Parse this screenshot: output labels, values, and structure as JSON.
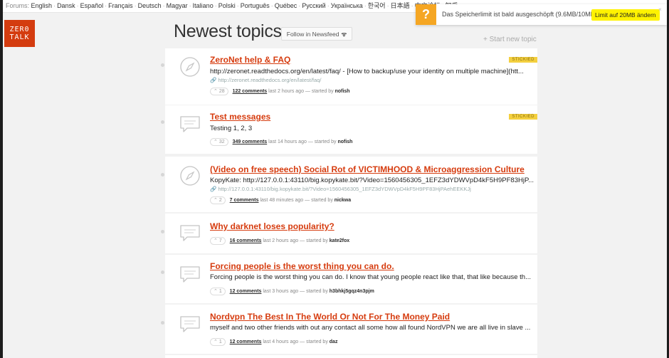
{
  "langbar": {
    "prefix": "Forums:",
    "languages": [
      "English",
      "Dansk",
      "Español",
      "Français",
      "Deutsch",
      "Magyar",
      "Italiano",
      "Polski",
      "Português",
      "Québec",
      "Русский",
      "Українська",
      "한국어",
      "日本語",
      "中文论坛",
      "知乎"
    ]
  },
  "notification": {
    "icon": "?",
    "message": "Das Speicherlimit ist bald ausgeschöpft (9.6MB/10MB)",
    "button": "Limit auf 20MB ändern",
    "close": "×"
  },
  "logo": {
    "line1": "ZER0",
    "line2": "TALK"
  },
  "header": {
    "title": "Newest topics",
    "follow_label": "Follow in Newsfeed",
    "follow_icon": "rss-icon",
    "rss": "ᯤ",
    "new_topic": "+ Start new topic"
  },
  "topics": [
    {
      "title": "ZeroNet help & FAQ",
      "body": "http://zeronet.readthedocs.org/en/latest/faq/ - [How to backup/use your identity on multiple machine](htt...",
      "link": "http://zeronet.readthedocs.org/en/latest/faq/",
      "votes": "28",
      "comments": "122 comments",
      "time": "last 2 hours ago",
      "started_prefix": "— started by",
      "author": "nofish",
      "badge": "STICKIED",
      "icon": "compass-icon"
    },
    {
      "title": "Test messages",
      "body": "Testing 1, 2, 3",
      "votes": "32",
      "comments": "349 comments",
      "time": "last 14 hours ago",
      "started_prefix": "— started by",
      "author": "nofish",
      "badge": "STICKIED",
      "icon": "chat-icon"
    },
    {
      "title": "(Video on free speech) Social Rot of VICTIMHOOD & Microaggression Culture",
      "body": "KopyKate: http://127.0.0.1:43110/big.kopykate.bit/?Video=1560456305_1EFZ3dYDWVpD4kF5H9PF83HjP...",
      "link": "http://127.0.0.1:43110/big.kopykate.bit/?Video=1560456305_1EFZ3dYDWVpD4kF5H9PF83HjPAehEEKKJj",
      "votes": "2",
      "comments": "7 comments",
      "time": "last 48 minutes ago",
      "started_prefix": "— started by",
      "author": "nickwa",
      "icon": "compass-icon"
    },
    {
      "title": "Why darknet loses popularity?",
      "votes": "7",
      "comments": "16 comments",
      "time": "last 2 hours ago",
      "started_prefix": "— started by",
      "author": "kate2fox",
      "icon": "chat-icon"
    },
    {
      "title": "Forcing people is the worst thing you can do.",
      "body": "Forcing people is the worst thing you can do. I know that young people react like that, that like because th...",
      "votes": "1",
      "comments": "12 comments",
      "time": "last 3 hours ago",
      "started_prefix": "— started by",
      "author": "h3bhkj5gqz4n3pjm",
      "icon": "chat-icon"
    },
    {
      "title": "Nordvpn The Best In The World Or Not For The Money Paid",
      "body": "myself and two other friends with out any contact all some how all found NordVPN we are all live in slave ...",
      "votes": "1",
      "comments": "12 comments",
      "time": "last 4 hours ago",
      "started_prefix": "— started by",
      "author": "daz",
      "icon": "chat-icon"
    }
  ],
  "colors": {
    "accent": "#d63c0f",
    "logo_bg": "#d43c0f",
    "sticky_bg": "#f4d03f",
    "warn": "#f5a623",
    "notif_button": "#fff200"
  }
}
